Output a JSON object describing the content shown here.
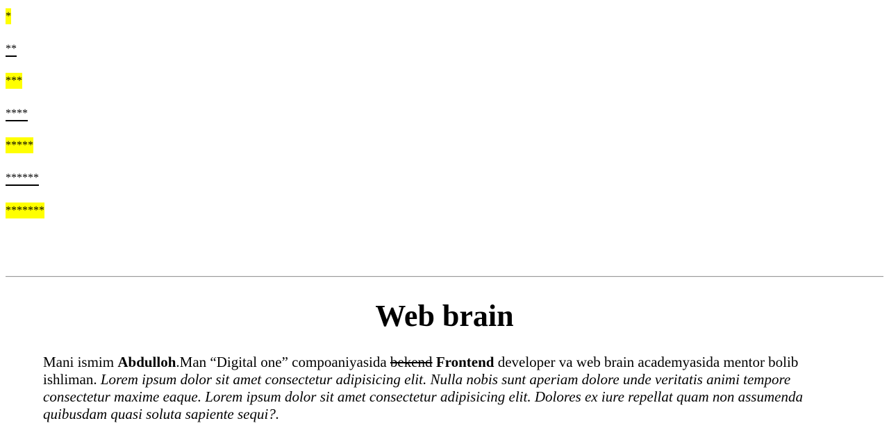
{
  "stars": [
    {
      "text": "*",
      "style": "highlight"
    },
    {
      "text": "**",
      "style": "underline"
    },
    {
      "text": "***",
      "style": "highlight"
    },
    {
      "text": "****",
      "style": "underline"
    },
    {
      "text": "*****",
      "style": "highlight"
    },
    {
      "text": "******",
      "style": "underline"
    },
    {
      "text": "*******",
      "style": "highlight"
    }
  ],
  "colors": {
    "highlight": "#ffff00",
    "divider": "#9a9a9a"
  },
  "heading": "Web brain",
  "paragraph": {
    "intro": "Mani ismim ",
    "name": "Abdulloh",
    "middle": ".Man “Digital one” compoaniyasida ",
    "struck": "bekend",
    "space": " ",
    "role": "Frontend",
    "after_role": " developer va web brain academyasida mentor bolib ishliman. ",
    "italic": "Lorem ipsum dolor sit amet consectetur adipisicing elit. Nulla nobis sunt aperiam dolore unde veritatis animi tempore consectetur maxime eaque. Lorem ipsum dolor sit amet consectetur adipisicing elit. Dolores ex iure repellat quam non assumenda quibusdam quasi soluta sapiente sequi?."
  }
}
